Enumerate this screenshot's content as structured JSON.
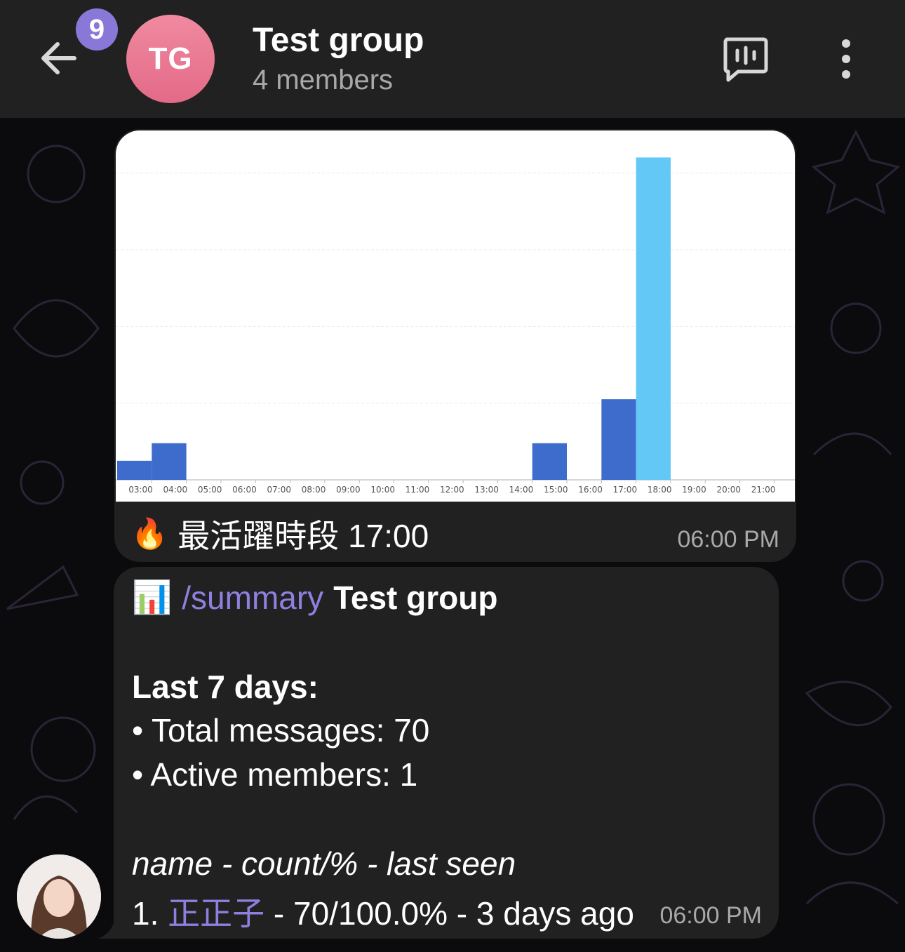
{
  "header": {
    "unread_count": "9",
    "avatar_initials": "TG",
    "title": "Test group",
    "subtitle": "4 members"
  },
  "messages": {
    "chart": {
      "caption_emoji": "🔥",
      "caption_text": "最活躍時段 17:00",
      "time": "06:00 PM"
    },
    "summary": {
      "emoji": "📊",
      "command": "/summary",
      "group": "Test group",
      "period": "Last 7 days:",
      "total_line": "• Total messages: 70",
      "active_line": "• Active members: 1",
      "columns_line": "name - count/% - last seen",
      "row_prefix": "1. ",
      "row_name": "正正子",
      "row_rest": " - 70/100.0% - 3 days ago",
      "time": "06:00 PM"
    }
  },
  "colors": {
    "bar_normal": "#3d6ccc",
    "bar_highlight": "#63c8f5",
    "accent_purple": "#8f80e0"
  },
  "chart_data": {
    "type": "bar",
    "categories": [
      "03:00",
      "04:00",
      "05:00",
      "06:00",
      "07:00",
      "08:00",
      "09:00",
      "10:00",
      "11:00",
      "12:00",
      "13:00",
      "14:00",
      "15:00",
      "16:00",
      "17:00",
      "18:00",
      "19:00",
      "20:00",
      "21:00"
    ],
    "values": [
      1.3,
      2.5,
      0,
      0,
      0,
      0,
      0,
      0,
      0,
      0,
      0,
      0,
      2.5,
      0,
      5.5,
      22,
      0,
      0,
      0
    ],
    "highlight_index": 15,
    "ylim": [
      0,
      22.5
    ],
    "grid": true,
    "title": "",
    "xlabel": "",
    "ylabel": ""
  }
}
